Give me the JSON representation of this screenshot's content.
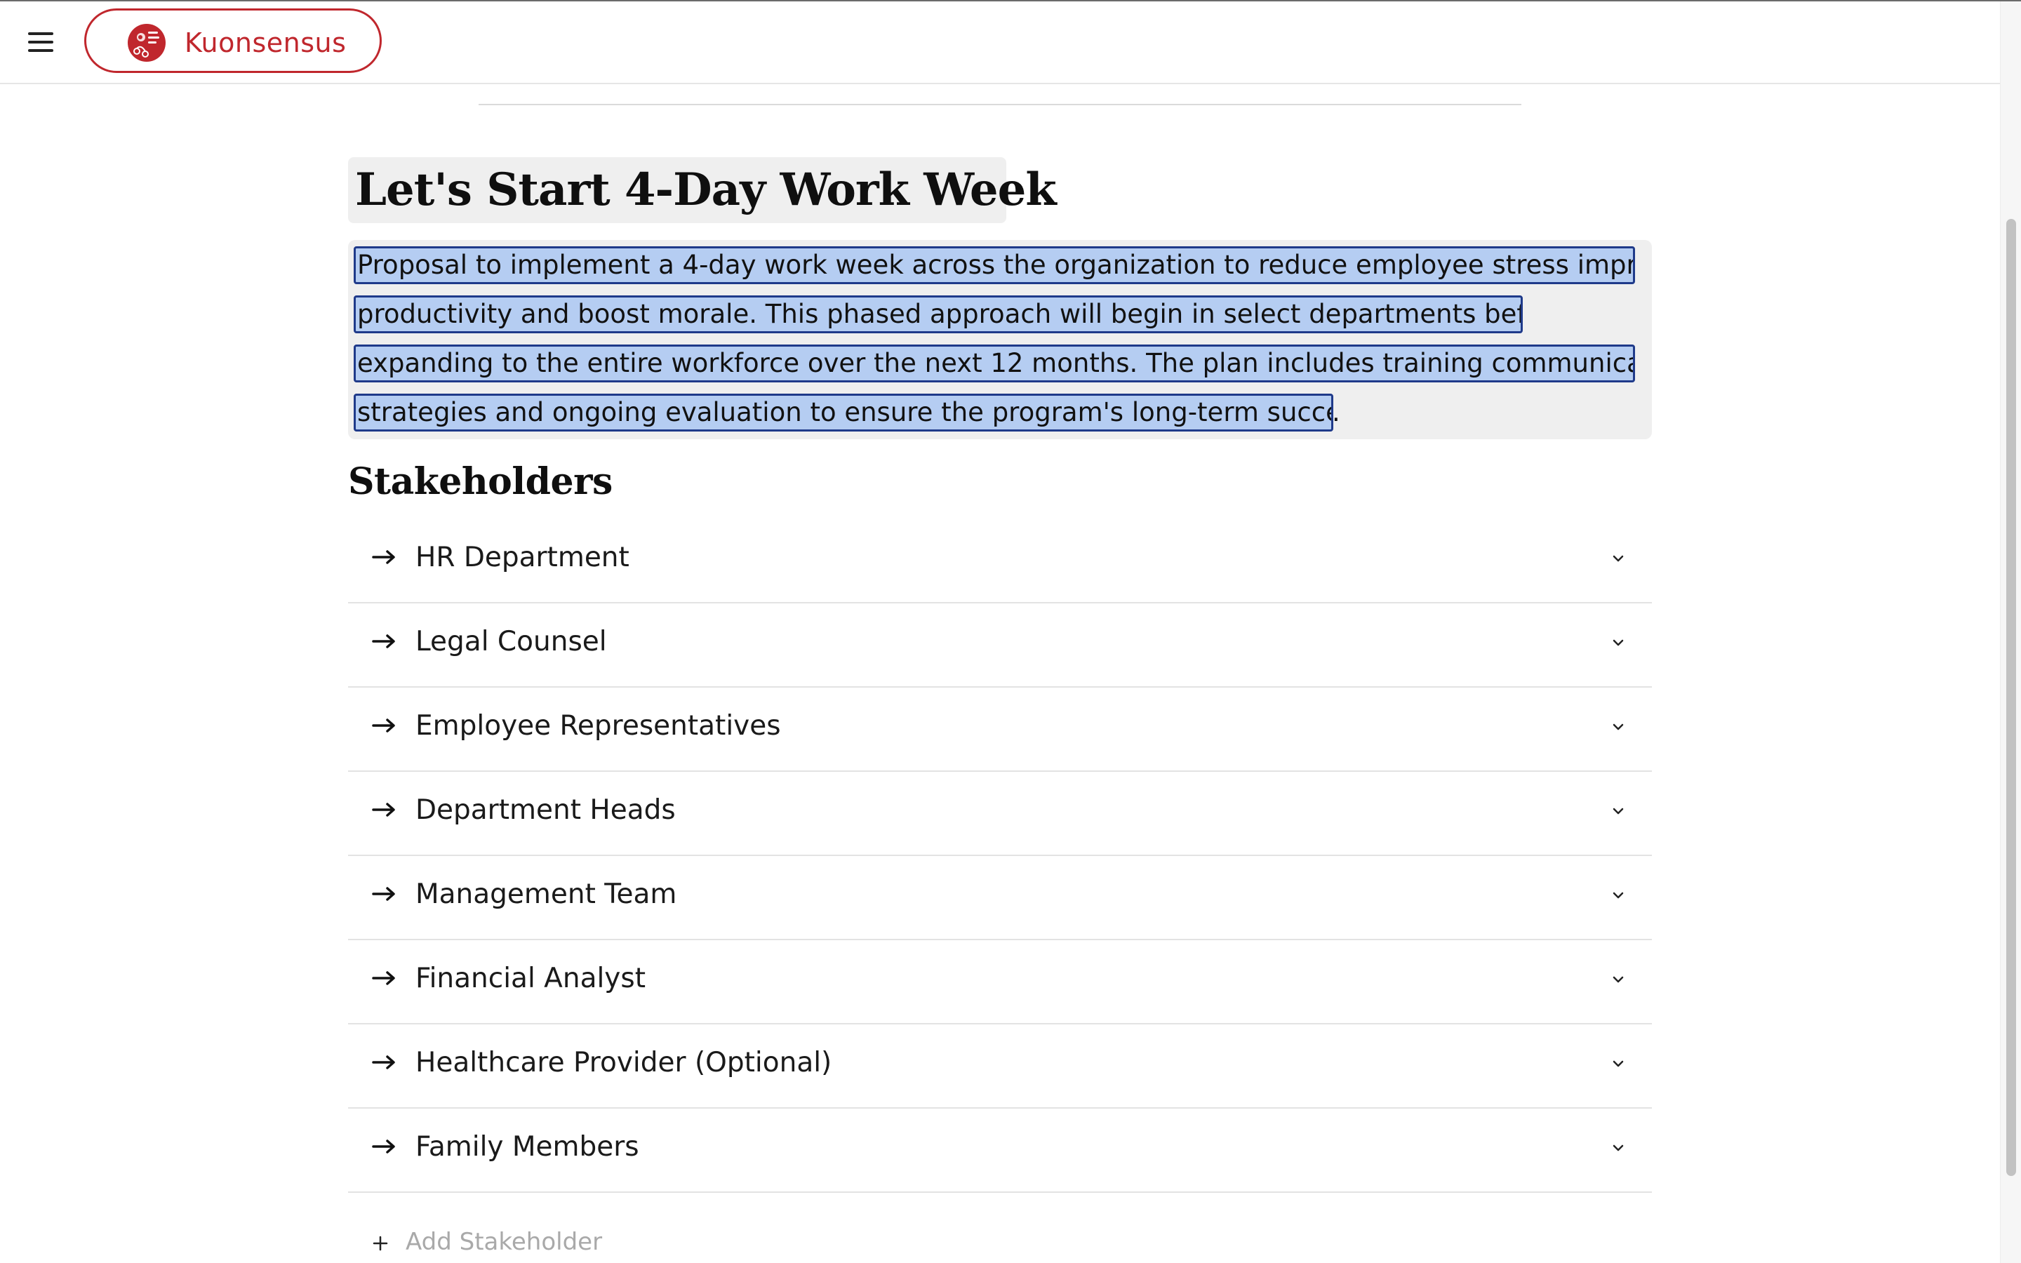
{
  "header": {
    "brand_name": "Kuonsensus",
    "brand_color": "#c0272d",
    "menu_icon": "hamburger-menu-icon",
    "logo_icon": "kuonsensus-logo-icon"
  },
  "proposal": {
    "title": "Let's Start 4-Day Work Week",
    "description_lines": [
      "Proposal to implement a 4-day work week across the organization to reduce employee stress improve",
      "productivity and boost morale. This phased approach will begin in select departments before",
      "expanding to the entire workforce over the next 12 months. The plan includes training communication",
      "strategies and ongoing evaluation to ensure the program's long-term success"
    ],
    "description_tail": "."
  },
  "stakeholders": {
    "heading": "Stakeholders",
    "items": [
      {
        "label": "HR Department"
      },
      {
        "label": "Legal Counsel"
      },
      {
        "label": "Employee Representatives"
      },
      {
        "label": "Department Heads"
      },
      {
        "label": "Management Team"
      },
      {
        "label": "Financial Analyst"
      },
      {
        "label": "Healthcare Provider (Optional)"
      },
      {
        "label": "Family Members"
      }
    ],
    "add_label": "Add Stakeholder",
    "item_icon": "arrow-right-icon",
    "expand_icon": "chevron-down-icon"
  },
  "colors": {
    "selection_fill": "#b5cdf2",
    "selection_border": "#1f3a8a",
    "box_background": "#efefef"
  }
}
